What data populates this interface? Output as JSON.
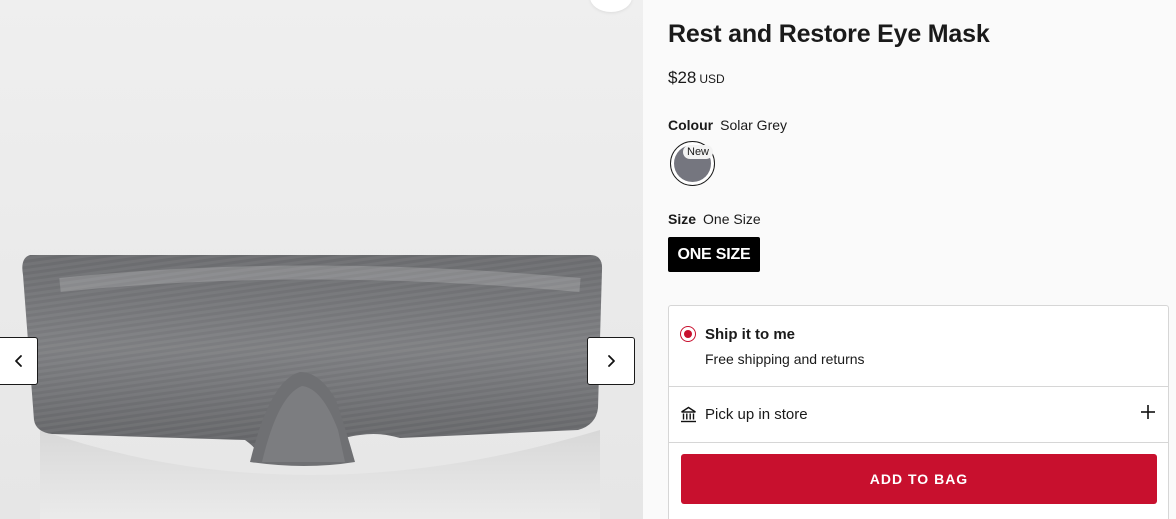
{
  "product": {
    "title": "Rest and Restore Eye Mask",
    "price": "$28",
    "currency": "USD"
  },
  "colour": {
    "label": "Colour",
    "selected": "Solar Grey",
    "swatch_color": "#75767f",
    "badge": "New"
  },
  "size": {
    "label": "Size",
    "selected": "One Size",
    "button_label": "ONE SIZE"
  },
  "delivery": {
    "ship_title": "Ship it to me",
    "ship_subtitle": "Free shipping and returns",
    "pickup_label": "Pick up in store"
  },
  "cta": {
    "add_to_bag": "ADD TO BAG"
  },
  "gallery": {
    "prev_icon": "chevron-left-icon",
    "next_icon": "chevron-right-icon"
  },
  "colors": {
    "accent": "#c8102e",
    "swatch": "#75767f"
  }
}
